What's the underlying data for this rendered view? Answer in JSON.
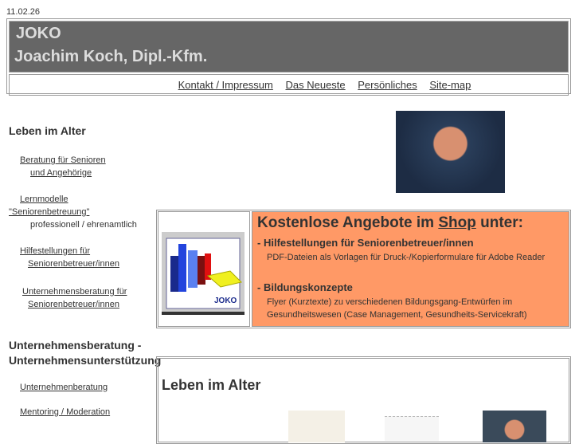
{
  "date": "11.02.26",
  "header": {
    "brand": "JOKO",
    "name": "Joachim Koch, Dipl.-Kfm.",
    "nav": [
      "Kontakt / Impressum",
      "Das Neueste",
      "Persönliches",
      "Site-map"
    ]
  },
  "sidebar": {
    "section1": "Leben im Alter",
    "links1": [
      {
        "l1": "Beratung für Senioren",
        "l2": "und Angehörige"
      },
      {
        "l1": "Lernmodelle",
        "l2": "\"Seniorenbetreuung\"",
        "note": "professionell / ehrenamtlich"
      },
      {
        "l1": "Hilfestellungen für",
        "l2": "Seniorenbetreuer/innen"
      },
      {
        "l1": "Unternehmensberatung für",
        "l2": "Seniorenbetreuer/innen"
      }
    ],
    "section2a": "Unternehmensberatung -",
    "section2b": "Unternehmensunterstützung",
    "links2": [
      "Unternehmenberatung",
      "Mentoring / Moderation"
    ]
  },
  "promo": {
    "title_pre": "Kostenlose Angebote im",
    "title_link": "Shop",
    "title_post": "unter:",
    "logo_text": "JOKO",
    "items": [
      {
        "title": "Hilfestellungen für Seniorenbetreuer/innen",
        "text": "PDF-Dateien als Vorlagen für Druck-/Kopierformulare für Adobe Reader"
      },
      {
        "title": "Bildungskonzepte",
        "text": "Flyer (Kurztexte) zu  verschiedenen Bildungsgang-Entwürfen im Gesundheitswesen (Case Management, Gesundheits-Servicekraft)"
      }
    ]
  },
  "section2": {
    "title": "Leben im Alter"
  }
}
